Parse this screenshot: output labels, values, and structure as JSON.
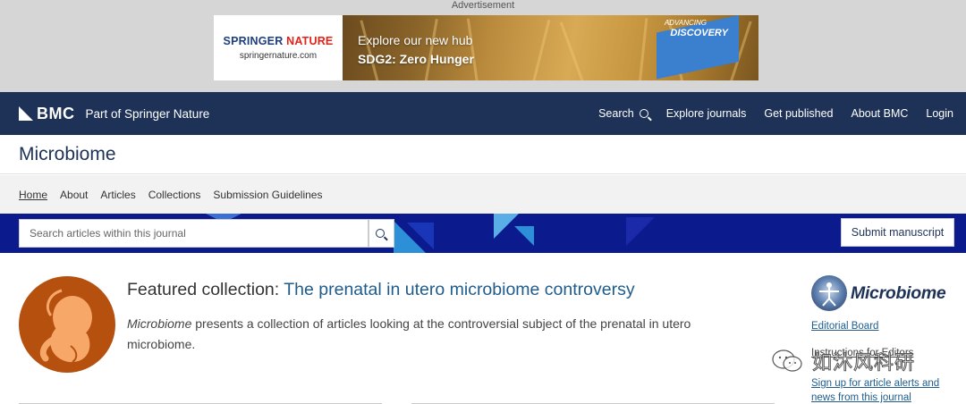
{
  "ad": {
    "label": "Advertisement",
    "brand_part1": "SPRINGER",
    "brand_part2": "NATURE",
    "domain": "springernature.com",
    "headline1": "Explore our new hub",
    "headline2": "SDG2: Zero Hunger",
    "badge_line1": "ADVANCING",
    "badge_line2": "DISCOVERY"
  },
  "top_nav": {
    "logo_text": "BMC",
    "tagline": "Part of Springer Nature",
    "search_label": "Search",
    "explore_label": "Explore journals",
    "published_label": "Get published",
    "about_label": "About BMC",
    "login_label": "Login"
  },
  "journal": {
    "title": "Microbiome"
  },
  "sub_nav": {
    "items": [
      "Home",
      "About",
      "Articles",
      "Collections",
      "Submission Guidelines"
    ]
  },
  "search": {
    "placeholder": "Search articles within this journal",
    "submit_label": "Submit manuscript"
  },
  "featured": {
    "prefix": "Featured collection: ",
    "link_text": "The prenatal in utero microbiome controversy",
    "desc_italic": "Microbiome",
    "desc_rest": " presents a collection of articles looking at the controversial subject of the prenatal in utero microbiome."
  },
  "sidebar": {
    "logo_text": "Microbiome",
    "editorial_board": "Editorial Board",
    "instructions": "Instructions for Editors",
    "signup": "Sign up for article alerts and news from this journal"
  },
  "watermark": {
    "text": "如沐风科研"
  },
  "colors": {
    "nav_bg": "#1e3257",
    "band_bg": "#0b1a8c",
    "link": "#1f5c8c",
    "fetus_bg": "#b5500f",
    "fetus_fg": "#f7a869"
  }
}
